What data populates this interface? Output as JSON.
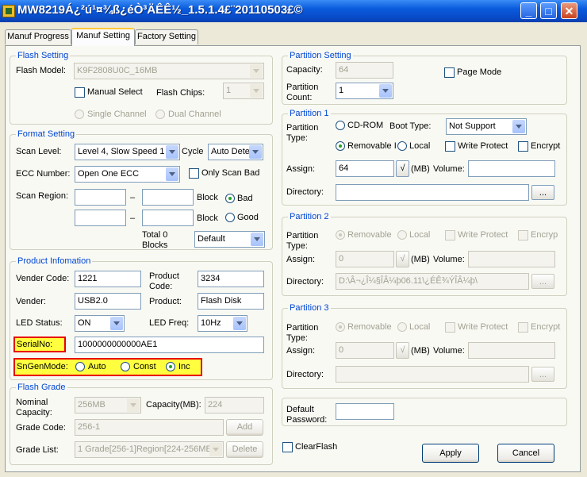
{
  "window": {
    "title": "MW8219Á¿²ú¹¤¾ß¿éÒ³ÄÊÊ½_1.5.1.4£¨20110503£©",
    "min": "_",
    "max": "□",
    "close": "✕"
  },
  "tabs": [
    "Manuf Progress",
    "Manuf Setting",
    "Factory Setting"
  ],
  "flash_setting": {
    "title": "Flash Setting",
    "model_label": "Flash Model:",
    "model_value": "K9F2808U0C_16MB",
    "manual_select": "Manual Select",
    "chips_label": "Flash Chips:",
    "chips_value": "1",
    "single_channel": "Single Channel",
    "dual_channel": "Dual Channel"
  },
  "format_setting": {
    "title": "Format Setting",
    "scan_level_label": "Scan Level:",
    "scan_level_value": "Level 4, Slow Speed 1",
    "cycle_label": "Cycle",
    "cycle_value": "Auto Dete",
    "ecc_label": "ECC Number:",
    "ecc_value": "Open One ECC",
    "only_scan_bad": "Only Scan Bad",
    "scan_region_label": "Scan Region:",
    "dash": "–",
    "block": "Block",
    "bad": "Bad",
    "good": "Good",
    "total_line1": "Total 0",
    "total_line2": "Blocks",
    "default_value": "Default"
  },
  "product_info": {
    "title": "Product Infomation",
    "vender_code_label": "Vender Code:",
    "vender_code_value": "1221",
    "product_code_label1": "Product",
    "product_code_label2": "Code:",
    "product_code_value": "3234",
    "vender_label": "Vender:",
    "vender_value": "USB2.0",
    "product_label": "Product:",
    "product_value": "Flash Disk",
    "led_status_label": "LED Status:",
    "led_status_value": "ON",
    "led_freq_label": "LED Freq:",
    "led_freq_value": "10Hz",
    "serial_label": "SerialNo:",
    "serial_value": "1000000000000AE1",
    "sngen_label": "SnGenMode:",
    "auto": "Auto",
    "const": "Const",
    "inc": "Inc"
  },
  "flash_grade": {
    "title": "Flash Grade",
    "nominal_label1": "Nominal",
    "nominal_label2": "Capacity:",
    "nominal_value": "256MB",
    "capacity_label": "Capacity(MB):",
    "capacity_value": "224",
    "grade_code_label": "Grade Code:",
    "grade_code_value": "256-1",
    "add": "Add",
    "grade_list_label": "Grade List:",
    "grade_list_value": "1 Grade[256-1]Region[224-256MB",
    "delete": "Delete"
  },
  "partition_setting": {
    "title": "Partition Setting",
    "capacity_label": "Capacity:",
    "capacity_value": "64",
    "count_label1": "Partition",
    "count_label2": "Count:",
    "count_value": "1",
    "page_mode": "Page Mode"
  },
  "partition1": {
    "title": "Partition 1",
    "type_label1": "Partition",
    "type_label2": "Type:",
    "cdrom": "CD-ROM",
    "boot_label": "Boot Type:",
    "boot_value": "Not Support",
    "removable": "Removable I",
    "local": "Local",
    "write_protect": "Write Protect",
    "encrypt": "Encrypt",
    "assign_label": "Assign:",
    "assign_value": "64",
    "sqrt": "√",
    "mb": "(MB)",
    "volume_label": "Volume:",
    "directory_label": "Directory:",
    "browse": "..."
  },
  "partition2": {
    "title": "Partition 2",
    "type_label1": "Partition",
    "type_label2": "Type:",
    "removable": "Removable",
    "local": "Local",
    "write_protect": "Write Protect",
    "encrypt": "Encryp",
    "assign_label": "Assign:",
    "assign_value": "0",
    "sqrt": "√",
    "mb": "(MB)",
    "volume_label": "Volume:",
    "directory_label": "Directory:",
    "directory_value": "D:\\Â¬¿Î¼§ÎÂ¼þ06.11\\¿ÉÊ¾ÝÎÂ¼þ\\",
    "browse": "..."
  },
  "partition3": {
    "title": "Partition 3",
    "type_label1": "Partition",
    "type_label2": "Type:",
    "removable": "Removable",
    "local": "Local",
    "write_protect": "Write Protect",
    "encrypt": "Encrypt",
    "assign_label": "Assign:",
    "assign_value": "0",
    "sqrt": "√",
    "mb": "(MB)",
    "volume_label": "Volume:",
    "directory_label": "Directory:",
    "browse": "..."
  },
  "default_password": {
    "label1": "Default",
    "label2": "Password:"
  },
  "bottom": {
    "clear_flash": "ClearFlash",
    "apply": "Apply",
    "cancel": "Cancel"
  }
}
